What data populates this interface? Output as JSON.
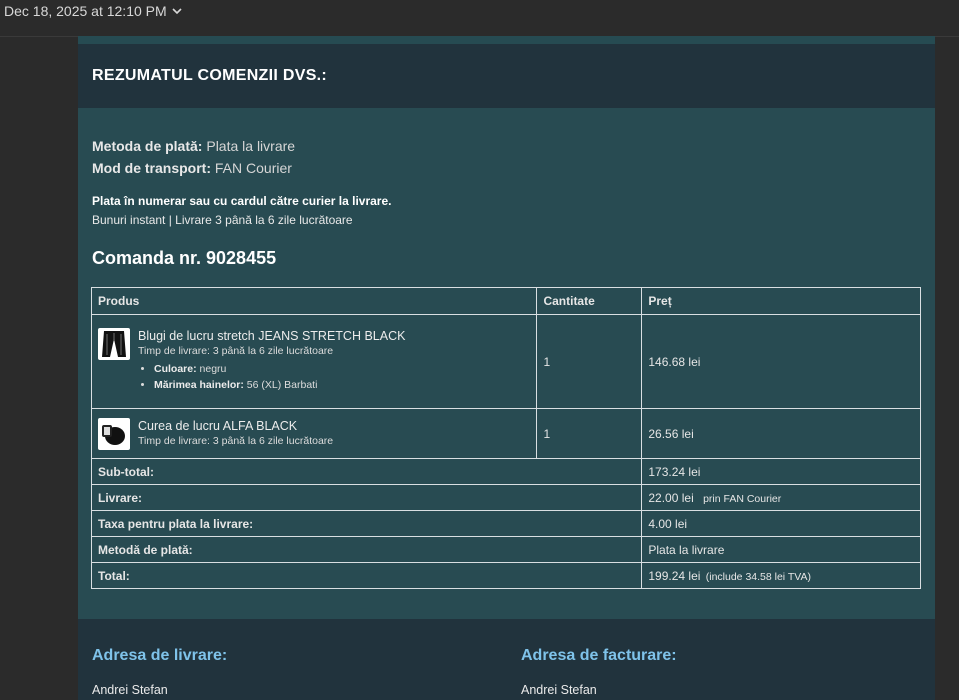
{
  "topbar": {
    "date": "Dec 18, 2025 at 12:10 PM"
  },
  "header": {
    "title": "REZUMATUL COMENZII DVS.:"
  },
  "summary": {
    "payment_label": "Metoda de plată:",
    "payment_value": "Plata la livrare",
    "shipping_label": "Mod de transport:",
    "shipping_value": "FAN Courier",
    "cash_note": "Plata în numerar sau cu cardul către curier la livrare.",
    "delivery_note": "Bunuri instant | Livrare 3 până la 6 zile lucrătoare",
    "order_number": "Comanda nr. 9028455"
  },
  "table": {
    "headers": {
      "product": "Produs",
      "quantity": "Cantitate",
      "price": "Preț"
    },
    "items": [
      {
        "name": "Blugi de lucru stretch JEANS STRETCH BLACK",
        "delivery": "Timp de livrare: 3 până la 6 zile lucrătoare",
        "attr1_label": "Culoare:",
        "attr1_value": "negru",
        "attr2_label": "Mărimea hainelor:",
        "attr2_value": "56 (XL) Barbati",
        "quantity": "1",
        "price": "146.68 lei",
        "icon": "jeans-icon"
      },
      {
        "name": "Curea de lucru ALFA BLACK",
        "delivery": "Timp de livrare: 3 până la 6 zile lucrătoare",
        "quantity": "1",
        "price": "26.56 lei",
        "icon": "belt-icon"
      }
    ],
    "totals": {
      "subtotal_label": "Sub-total:",
      "subtotal_value": "173.24 lei",
      "delivery_label": "Livrare:",
      "delivery_value": "22.00 lei",
      "delivery_aside": "prin FAN Courier",
      "cod_fee_label": "Taxa pentru plata la livrare:",
      "cod_fee_value": "4.00 lei",
      "method_label": "Metodă de plată:",
      "method_value": "Plata la livrare",
      "total_label": "Total:",
      "total_value": "199.24 lei",
      "total_aside": "(include 34.58 lei TVA)"
    }
  },
  "addresses": {
    "shipping_title": "Adresa de livrare:",
    "billing_title": "Adresa de facturare:",
    "shipping_name": "Andrei Stefan",
    "billing_name": "Andrei Stefan"
  },
  "colors": {
    "page_bg": "#2b2b2b",
    "header_bg": "#21333d",
    "summary_bg": "#284b52",
    "address_title": "#7fc3ea"
  }
}
